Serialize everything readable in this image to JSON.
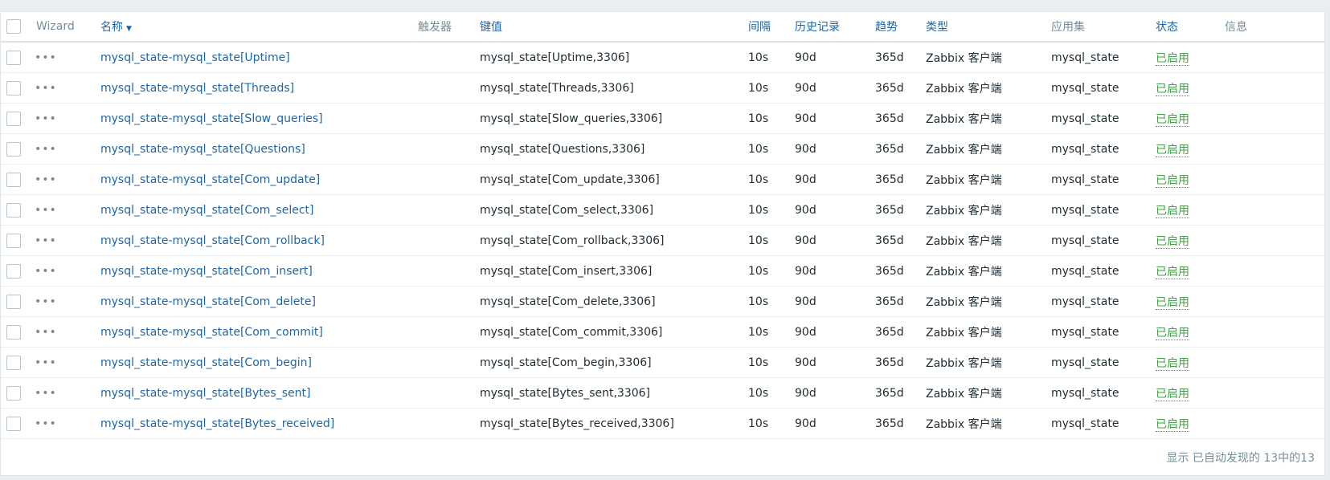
{
  "header": {
    "wizard": "Wizard",
    "name": "名称",
    "triggers": "触发器",
    "key": "键值",
    "interval": "间隔",
    "history": "历史记录",
    "trends": "趋势",
    "type": "类型",
    "applications": "应用集",
    "status": "状态",
    "info": "信息"
  },
  "rows": [
    {
      "name": "mysql_state-mysql_state[Uptime]",
      "key": "mysql_state[Uptime,3306]",
      "interval": "10s",
      "history": "90d",
      "trends": "365d",
      "type": "Zabbix 客户端",
      "app": "mysql_state",
      "status": "已启用"
    },
    {
      "name": "mysql_state-mysql_state[Threads]",
      "key": "mysql_state[Threads,3306]",
      "interval": "10s",
      "history": "90d",
      "trends": "365d",
      "type": "Zabbix 客户端",
      "app": "mysql_state",
      "status": "已启用"
    },
    {
      "name": "mysql_state-mysql_state[Slow_queries]",
      "key": "mysql_state[Slow_queries,3306]",
      "interval": "10s",
      "history": "90d",
      "trends": "365d",
      "type": "Zabbix 客户端",
      "app": "mysql_state",
      "status": "已启用"
    },
    {
      "name": "mysql_state-mysql_state[Questions]",
      "key": "mysql_state[Questions,3306]",
      "interval": "10s",
      "history": "90d",
      "trends": "365d",
      "type": "Zabbix 客户端",
      "app": "mysql_state",
      "status": "已启用"
    },
    {
      "name": "mysql_state-mysql_state[Com_update]",
      "key": "mysql_state[Com_update,3306]",
      "interval": "10s",
      "history": "90d",
      "trends": "365d",
      "type": "Zabbix 客户端",
      "app": "mysql_state",
      "status": "已启用"
    },
    {
      "name": "mysql_state-mysql_state[Com_select]",
      "key": "mysql_state[Com_select,3306]",
      "interval": "10s",
      "history": "90d",
      "trends": "365d",
      "type": "Zabbix 客户端",
      "app": "mysql_state",
      "status": "已启用"
    },
    {
      "name": "mysql_state-mysql_state[Com_rollback]",
      "key": "mysql_state[Com_rollback,3306]",
      "interval": "10s",
      "history": "90d",
      "trends": "365d",
      "type": "Zabbix 客户端",
      "app": "mysql_state",
      "status": "已启用"
    },
    {
      "name": "mysql_state-mysql_state[Com_insert]",
      "key": "mysql_state[Com_insert,3306]",
      "interval": "10s",
      "history": "90d",
      "trends": "365d",
      "type": "Zabbix 客户端",
      "app": "mysql_state",
      "status": "已启用"
    },
    {
      "name": "mysql_state-mysql_state[Com_delete]",
      "key": "mysql_state[Com_delete,3306]",
      "interval": "10s",
      "history": "90d",
      "trends": "365d",
      "type": "Zabbix 客户端",
      "app": "mysql_state",
      "status": "已启用"
    },
    {
      "name": "mysql_state-mysql_state[Com_commit]",
      "key": "mysql_state[Com_commit,3306]",
      "interval": "10s",
      "history": "90d",
      "trends": "365d",
      "type": "Zabbix 客户端",
      "app": "mysql_state",
      "status": "已启用"
    },
    {
      "name": "mysql_state-mysql_state[Com_begin]",
      "key": "mysql_state[Com_begin,3306]",
      "interval": "10s",
      "history": "90d",
      "trends": "365d",
      "type": "Zabbix 客户端",
      "app": "mysql_state",
      "status": "已启用"
    },
    {
      "name": "mysql_state-mysql_state[Bytes_sent]",
      "key": "mysql_state[Bytes_sent,3306]",
      "interval": "10s",
      "history": "90d",
      "trends": "365d",
      "type": "Zabbix 客户端",
      "app": "mysql_state",
      "status": "已启用"
    },
    {
      "name": "mysql_state-mysql_state[Bytes_received]",
      "key": "mysql_state[Bytes_received,3306]",
      "interval": "10s",
      "history": "90d",
      "trends": "365d",
      "type": "Zabbix 客户端",
      "app": "mysql_state",
      "status": "已启用"
    }
  ],
  "footer": "显示 已自动发现的 13中的13"
}
